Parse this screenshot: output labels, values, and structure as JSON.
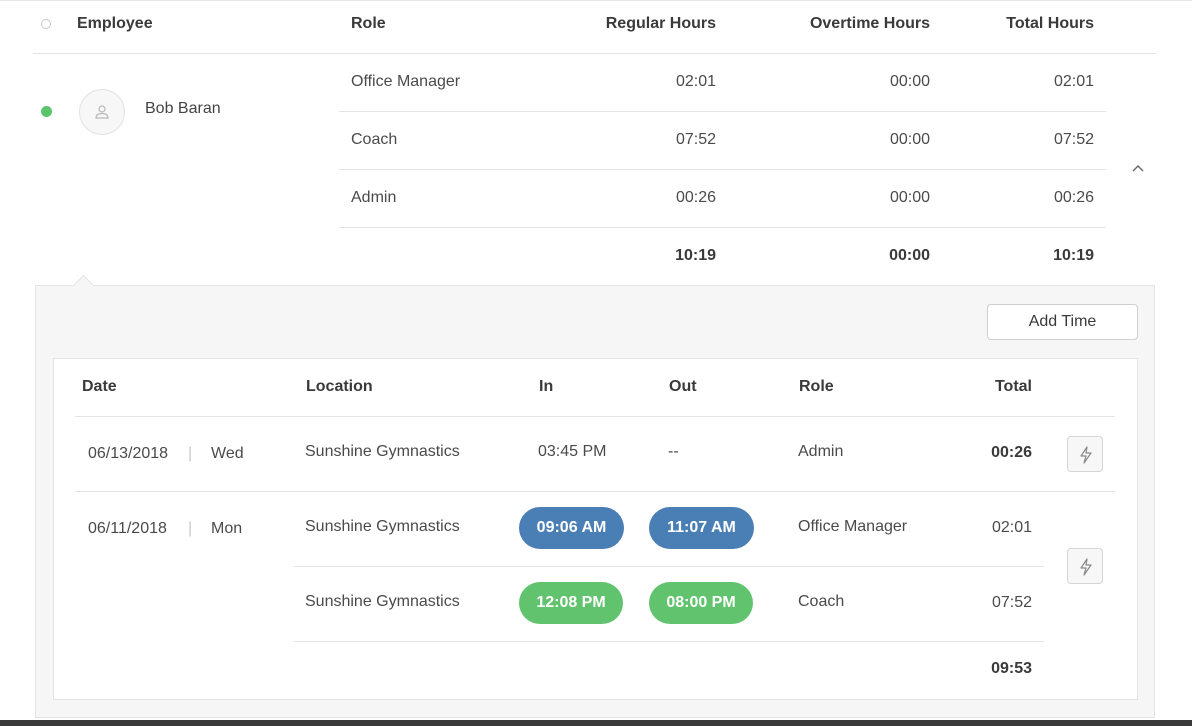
{
  "header": {
    "employee": "Employee",
    "role": "Role",
    "regular_hours": "Regular Hours",
    "overtime_hours": "Overtime Hours",
    "total_hours": "Total Hours"
  },
  "employee": {
    "name": "Bob Baran",
    "status_color": "#5cc46a",
    "roles": [
      {
        "role": "Office Manager",
        "regular": "02:01",
        "overtime": "00:00",
        "total": "02:01"
      },
      {
        "role": "Coach",
        "regular": "07:52",
        "overtime": "00:00",
        "total": "07:52"
      },
      {
        "role": "Admin",
        "regular": "00:26",
        "overtime": "00:00",
        "total": "00:26"
      }
    ],
    "totals": {
      "regular": "10:19",
      "overtime": "00:00",
      "total": "10:19"
    }
  },
  "details": {
    "add_time_label": "Add Time",
    "columns": {
      "date": "Date",
      "location": "Location",
      "in": "In",
      "out": "Out",
      "role": "Role",
      "total": "Total"
    },
    "separator": "|",
    "entries": [
      {
        "date": "06/13/2018",
        "day": "Wed",
        "shifts": [
          {
            "location": "Sunshine Gymnastics",
            "in": "03:45 PM",
            "out": "--",
            "role": "Admin",
            "total": "00:26"
          }
        ]
      },
      {
        "date": "06/11/2018",
        "day": "Mon",
        "shifts": [
          {
            "location": "Sunshine Gymnastics",
            "in": "09:06 AM",
            "out": "11:07 AM",
            "role": "Office Manager",
            "total": "02:01"
          },
          {
            "location": "Sunshine Gymnastics",
            "in": "12:08 PM",
            "out": "08:00 PM",
            "role": "Coach",
            "total": "07:52"
          }
        ],
        "day_total": "09:53"
      }
    ],
    "pill_colors": {
      "blue": "#4a7fb5",
      "green": "#62c36e"
    }
  }
}
